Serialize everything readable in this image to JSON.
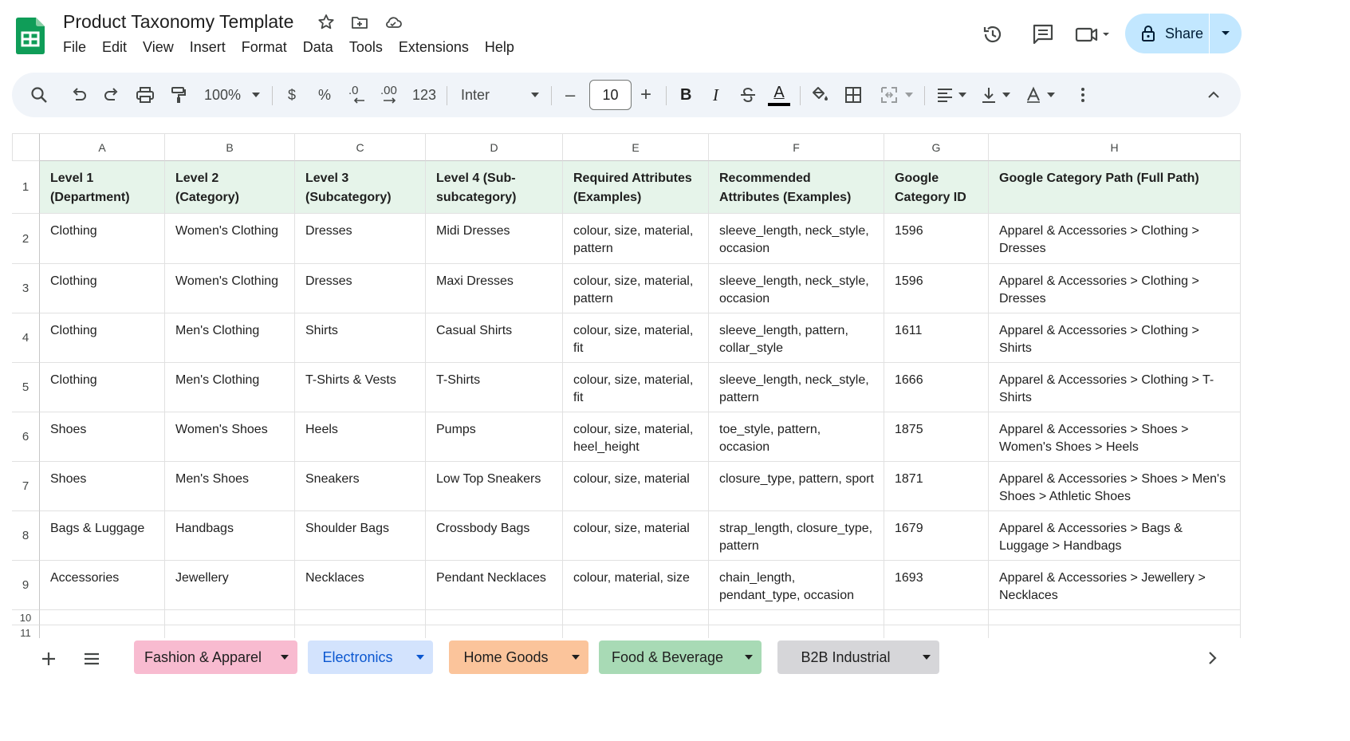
{
  "document": {
    "title": "Product Taxonomy Template"
  },
  "menu": [
    "File",
    "Edit",
    "View",
    "Insert",
    "Format",
    "Data",
    "Tools",
    "Extensions",
    "Help"
  ],
  "share": {
    "label": "Share"
  },
  "toolbar": {
    "zoom": "100%",
    "currency": "$",
    "percent": "%",
    "decrease_decimal": ".0",
    "increase_decimal": ".00",
    "more_formats": "123",
    "font": "Inter",
    "font_size": "10",
    "minus": "–",
    "plus": "+",
    "bold": "B",
    "italic": "I",
    "text_color": "A",
    "text_color_hex": "#000000"
  },
  "columns": [
    "A",
    "B",
    "C",
    "D",
    "E",
    "F",
    "G",
    "H"
  ],
  "row_numbers": [
    "1",
    "2",
    "3",
    "4",
    "5",
    "6",
    "7",
    "8",
    "9",
    "10",
    "11"
  ],
  "header_row": [
    "Level 1 (Department)",
    "Level 2 (Category)",
    "Level 3 (Subcategory)",
    "Level 4 (Sub-subcategory)",
    "Required Attributes (Examples)",
    "Recommended Attributes (Examples)",
    "Google Category ID",
    "Google Category Path (Full Path)"
  ],
  "rows": [
    [
      "Clothing",
      "Women's Clothing",
      "Dresses",
      "Midi Dresses",
      "colour, size, material, pattern",
      "sleeve_length, neck_style, occasion",
      "1596",
      "Apparel & Accessories > Clothing > Dresses"
    ],
    [
      "Clothing",
      "Women's Clothing",
      "Dresses",
      "Maxi Dresses",
      "colour, size, material, pattern",
      "sleeve_length, neck_style, occasion",
      "1596",
      "Apparel & Accessories > Clothing > Dresses"
    ],
    [
      "Clothing",
      "Men's Clothing",
      "Shirts",
      "Casual Shirts",
      "colour, size, material, fit",
      "sleeve_length, pattern, collar_style",
      "1611",
      "Apparel & Accessories > Clothing > Shirts"
    ],
    [
      "Clothing",
      "Men's Clothing",
      "T-Shirts & Vests",
      "T-Shirts",
      "colour, size, material, fit",
      "sleeve_length, neck_style, pattern",
      "1666",
      "Apparel & Accessories > Clothing > T-Shirts"
    ],
    [
      "Shoes",
      "Women's Shoes",
      "Heels",
      "Pumps",
      "colour, size, material, heel_height",
      "toe_style, pattern, occasion",
      "1875",
      "Apparel & Accessories > Shoes > Women's Shoes > Heels"
    ],
    [
      "Shoes",
      "Men's Shoes",
      "Sneakers",
      "Low Top Sneakers",
      "colour, size, material",
      "closure_type, pattern, sport",
      "1871",
      "Apparel & Accessories > Shoes > Men's Shoes > Athletic Shoes"
    ],
    [
      "Bags & Luggage",
      "Handbags",
      "Shoulder Bags",
      "Crossbody Bags",
      "colour, size, material",
      "strap_length, closure_type, pattern",
      "1679",
      "Apparel & Accessories > Bags & Luggage > Handbags"
    ],
    [
      "Accessories",
      "Jewellery",
      "Necklaces",
      "Pendant Necklaces",
      "colour, material, size",
      "chain_length, pendant_type, occasion",
      "1693",
      "Apparel & Accessories > Jewellery > Necklaces"
    ],
    [
      "",
      "",
      "",
      "",
      "",
      "",
      "",
      ""
    ],
    [
      "",
      "",
      "",
      "",
      "",
      "",
      "",
      ""
    ]
  ],
  "colors": {
    "header_fill": "#e6f4ea",
    "share_fill": "#c2e7ff",
    "sheets_logo": "#0f9d58"
  },
  "sheet_tabs": [
    {
      "label": "Fashion & Apparel",
      "color": "#f8bbd0"
    },
    {
      "label": "Electronics",
      "color": "#d3e3fd"
    },
    {
      "label": "Home Goods",
      "color": "#fbc49b"
    },
    {
      "label": "Food & Beverage",
      "color": "#a8dab5"
    },
    {
      "label": "B2B Industrial",
      "color": "#d6d6d9"
    }
  ]
}
